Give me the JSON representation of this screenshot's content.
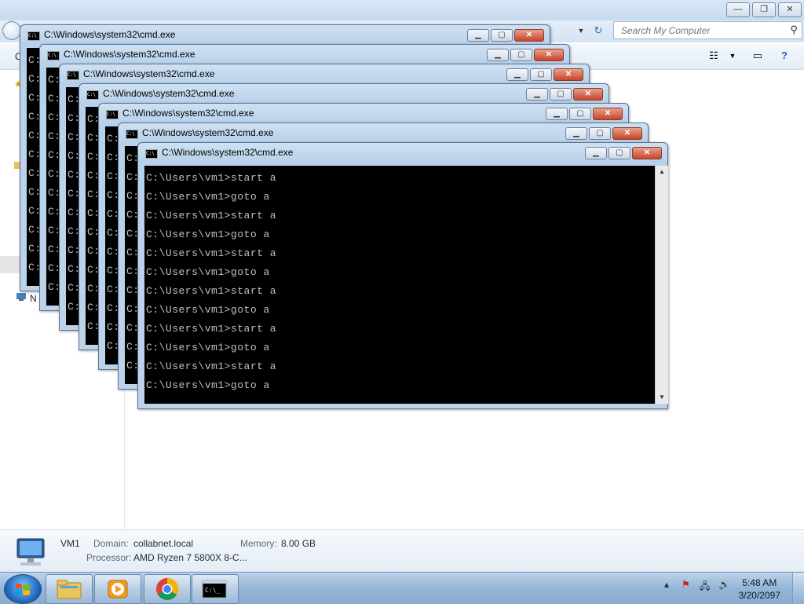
{
  "explorer": {
    "window_controls": {
      "minimize": "—",
      "maximize": "❐",
      "close": "✕"
    },
    "search_placeholder": "Search My Computer",
    "toolbar_left_label": "O",
    "nav_network_label": "N",
    "details": {
      "name": "VM1",
      "domain_label": "Domain:",
      "domain_value": "collabnet.local",
      "memory_label": "Memory:",
      "memory_value": "8.00 GB",
      "processor_label": "Processor:",
      "processor_value": "AMD Ryzen 7 5800X 8-C..."
    }
  },
  "cmd": {
    "title": "C:\\Windows\\system32\\cmd.exe",
    "prompt_lines": [
      "C:\\Users\\vm1>start a",
      "C:\\Users\\vm1>goto a",
      "C:\\Users\\vm1>start a",
      "C:\\Users\\vm1>goto a",
      "C:\\Users\\vm1>start a",
      "C:\\Users\\vm1>goto a",
      "C:\\Users\\vm1>start a",
      "C:\\Users\\vm1>goto a",
      "C:\\Users\\vm1>start a",
      "C:\\Users\\vm1>goto a",
      "C:\\Users\\vm1>start a",
      "C:\\Users\\vm1>goto a"
    ],
    "edge_char": "C:"
  },
  "taskbar": {
    "apps": [
      "windows-explorer",
      "media-player",
      "chrome",
      "cmd"
    ],
    "time": "5:48 AM",
    "date": "3/20/2097"
  }
}
